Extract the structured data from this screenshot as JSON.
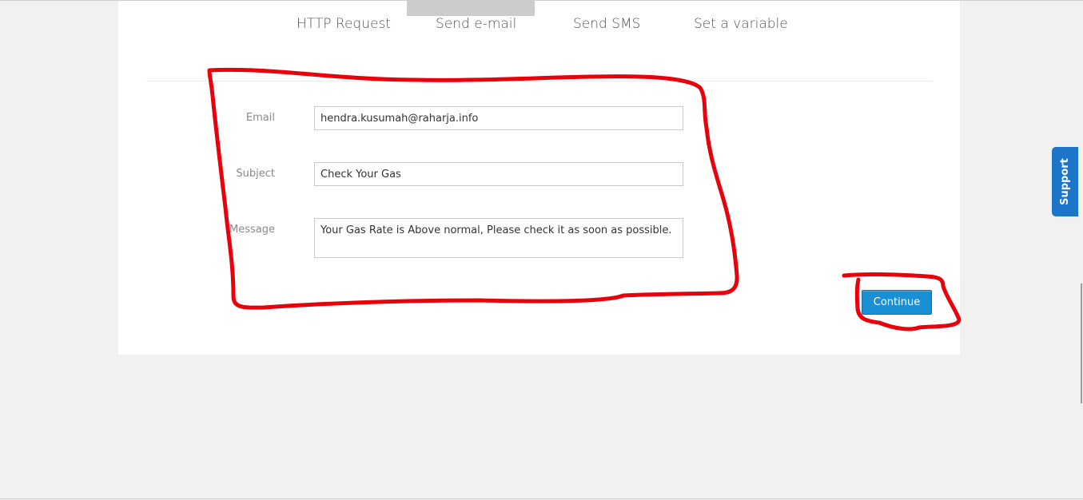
{
  "tabs": [
    {
      "label": "HTTP Request"
    },
    {
      "label": "Send e-mail"
    },
    {
      "label": "Send SMS"
    },
    {
      "label": "Set a variable"
    }
  ],
  "active_tab": "Send e-mail",
  "form": {
    "email": {
      "label": "Email",
      "value": "hendra.kusumah@raharja.info"
    },
    "subject": {
      "label": "Subject",
      "value": "Check Your Gas"
    },
    "message": {
      "label": "Message",
      "value": "Your Gas Rate is Above normal, Please check it as soon as possible."
    }
  },
  "continue_label": "Continue",
  "support_label": "Support",
  "colors": {
    "accent": "#1b8fd3",
    "support": "#1b75c9",
    "annotation": "#e8000b"
  }
}
